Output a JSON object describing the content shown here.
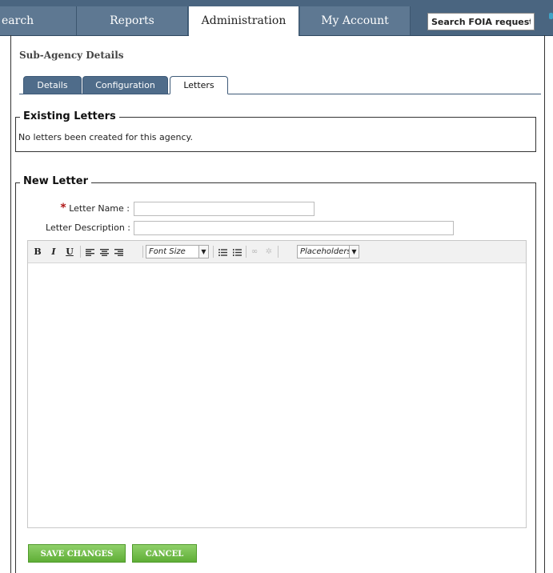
{
  "nav": {
    "tabs": [
      {
        "label": "earch"
      },
      {
        "label": "Reports"
      },
      {
        "label": "Administration"
      },
      {
        "label": "My Account"
      }
    ],
    "search_placeholder": "Search FOIA requests..."
  },
  "page": {
    "title": "Sub-Agency Details"
  },
  "subtabs": [
    {
      "label": "Details"
    },
    {
      "label": "Configuration"
    },
    {
      "label": "Letters"
    }
  ],
  "existing_letters": {
    "legend": "Existing Letters",
    "message": "No letters been created for this agency."
  },
  "new_letter": {
    "legend": "New Letter",
    "required_mark": "*",
    "name_label": "Letter Name :",
    "name_value": "",
    "description_label": "Letter Description :",
    "description_value": "",
    "toolbar": {
      "bold": "B",
      "italic": "I",
      "underline": "U",
      "font_size": "Font Size",
      "placeholders": "Placeholders"
    }
  },
  "actions": {
    "save": "SAVE CHANGES",
    "cancel": "CANCEL"
  },
  "colors": {
    "nav_bg": "#4a6580",
    "subtab_bg": "#4f6c8a",
    "button_green": "#6cbf3f",
    "required_red": "#b01818"
  }
}
